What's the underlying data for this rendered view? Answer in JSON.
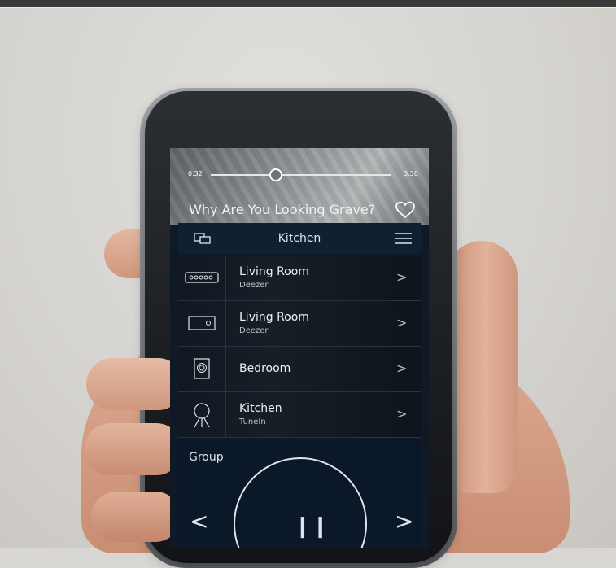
{
  "player": {
    "elapsed": "0.32",
    "duration": "3.30",
    "progress_fraction": 0.36,
    "song_title": "Why Are You Looking Grave?"
  },
  "header": {
    "title": "Kitchen"
  },
  "rooms": [
    {
      "name": "Living Room",
      "service": "Deezer",
      "icon": "soundbar-icon"
    },
    {
      "name": "Living Room",
      "service": "Deezer",
      "icon": "compact-speaker-icon"
    },
    {
      "name": "Bedroom",
      "service": "",
      "icon": "floor-speaker-icon"
    },
    {
      "name": "Kitchen",
      "service": "TuneIn",
      "icon": "tripod-speaker-icon"
    }
  ],
  "group": {
    "label": "Group"
  },
  "icons": {
    "previous": "chevron-left-icon",
    "next": "chevron-right-icon",
    "pause": "pause-icon",
    "favorite": "heart-icon",
    "menu": "hamburger-menu-icon",
    "devices": "devices-icon"
  },
  "colors": {
    "screen_background": "#0f1a26",
    "accent_text": "#dfe5ea"
  }
}
